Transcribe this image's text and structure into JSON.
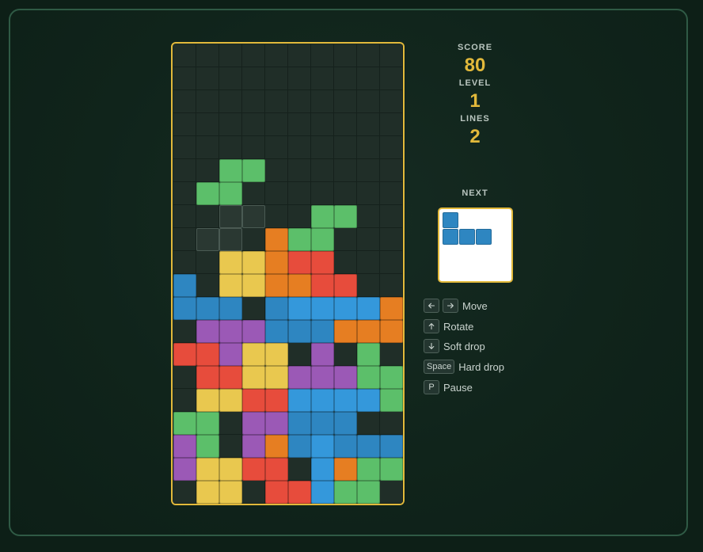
{
  "stats": {
    "score_label": "SCORE",
    "score": "80",
    "level_label": "LEVEL",
    "level": "1",
    "lines_label": "LINES",
    "lines": "2"
  },
  "next": {
    "label": "NEXT",
    "piece": "J",
    "color": "#2e86c1"
  },
  "controls": [
    {
      "keys": [
        "arrow-left-icon",
        "arrow-right-icon"
      ],
      "key_text": [],
      "label": "Move"
    },
    {
      "keys": [
        "arrow-up-icon"
      ],
      "key_text": [],
      "label": "Rotate"
    },
    {
      "keys": [
        "arrow-down-icon"
      ],
      "key_text": [],
      "label": "Soft drop"
    },
    {
      "keys": [],
      "key_text": [
        "Space"
      ],
      "label": "Hard drop"
    },
    {
      "keys": [],
      "key_text": [
        "P"
      ],
      "label": "Pause"
    }
  ],
  "colors": {
    "G": "#5cbf6a",
    "O": "#e67e22",
    "R": "#e74c3c",
    "Y": "#e9c84f",
    "B": "#2e86c1",
    "L": "#3498db",
    "P": "#9b59b6",
    "accent": "#e2b93b"
  },
  "board": {
    "cols": 10,
    "rows": 20,
    "grid": [
      "..........",
      "..........",
      "..........",
      "..........",
      "..........",
      "..GG......",
      ".GG.......",
      "..gg..GG..",
      ".gg.OGG...",
      "..YYORR...",
      "B.YYOORR..",
      "BBB.BLLLLO",
      ".PPPBBBOOO",
      "RRPYY.P.G.",
      ".RRYYPPPGG",
      ".YYRRLLLLG",
      "GG.PPBBB..",
      "PG.POBLBBB",
      "PYYRR.LOGG",
      ".YY.RRLGG."
    ]
  }
}
